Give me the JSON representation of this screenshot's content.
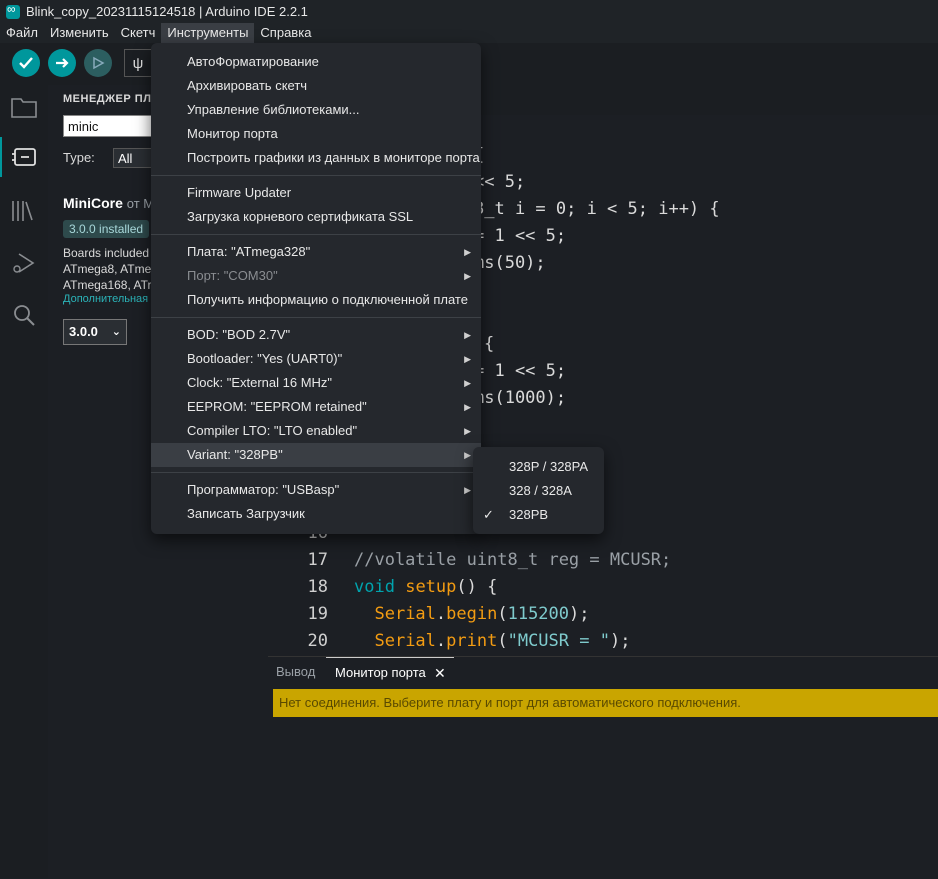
{
  "window": {
    "title": "Blink_copy_20231115124518 | Arduino IDE 2.2.1"
  },
  "menubar": {
    "items": [
      "Файл",
      "Изменить",
      "Скетч",
      "Инструменты",
      "Справка"
    ]
  },
  "sidebar": {
    "title": "МЕНЕДЖЕР ПЛА",
    "search_value": "minic",
    "type_label": "Type:",
    "type_value": "All",
    "core_name": "MiniCore",
    "core_by": "от M",
    "installed_badge": "3.0.0 installed",
    "desc_line1": "Boards included",
    "desc_line2": "ATmega8, ATme",
    "desc_line3": "ATmega168, ATr",
    "more_link": "Дополнительная",
    "version": "3.0.0"
  },
  "tools_menu": {
    "groups": [
      [
        "АвтоФорматирование",
        "Архивировать скетч",
        "Управление библиотеками...",
        "Монитор порта",
        "Построить графики из данных в мониторе порта"
      ],
      [
        "Firmware Updater",
        "Загрузка корневого сертификата SSL"
      ],
      [
        "Плата: \"ATmega328\"",
        "Порт: \"COM30\"",
        "Получить информацию о подключенной плате"
      ],
      [
        "BOD: \"BOD 2.7V\"",
        "Bootloader: \"Yes (UART0)\"",
        "Clock: \"External 16 MHz\"",
        "EEPROM: \"EEPROM retained\"",
        "Compiler LTO: \"LTO enabled\"",
        "Variant: \"328PB\""
      ],
      [
        "Программатор: \"USBasp\"",
        "Записать Загрузчик"
      ]
    ]
  },
  "variant_submenu": {
    "items": [
      "328P / 328PA",
      "328 / 328A",
      "328PB"
    ],
    "selected": "328PB"
  },
  "editor": {
    "partial_lines": [
      "{",
      "<< 5;",
      "8_t i = 0; i < 5; i++) {",
      "= 1 << 5;",
      "ms(50);",
      "{",
      "= 1 << 5;",
      "ms(1000);"
    ],
    "line_numbers": [
      "16",
      "17",
      "18",
      "19",
      "20"
    ],
    "line17": "//volatile uint8_t reg = MCUSR;",
    "line18_kw": "void",
    "line18_fn": "setup",
    "line18_rest": "() {",
    "line19_obj": "Serial",
    "line19_fn": "begin",
    "line19_num": "115200",
    "line20_obj": "Serial",
    "line20_fn": "print",
    "line20_str": "\"MCUSR = \""
  },
  "bottom_panel": {
    "tab_output": "Вывод",
    "tab_monitor": "Монитор порта",
    "banner": "Нет соединения. Выберите плату и порт для автоматического подключения."
  }
}
